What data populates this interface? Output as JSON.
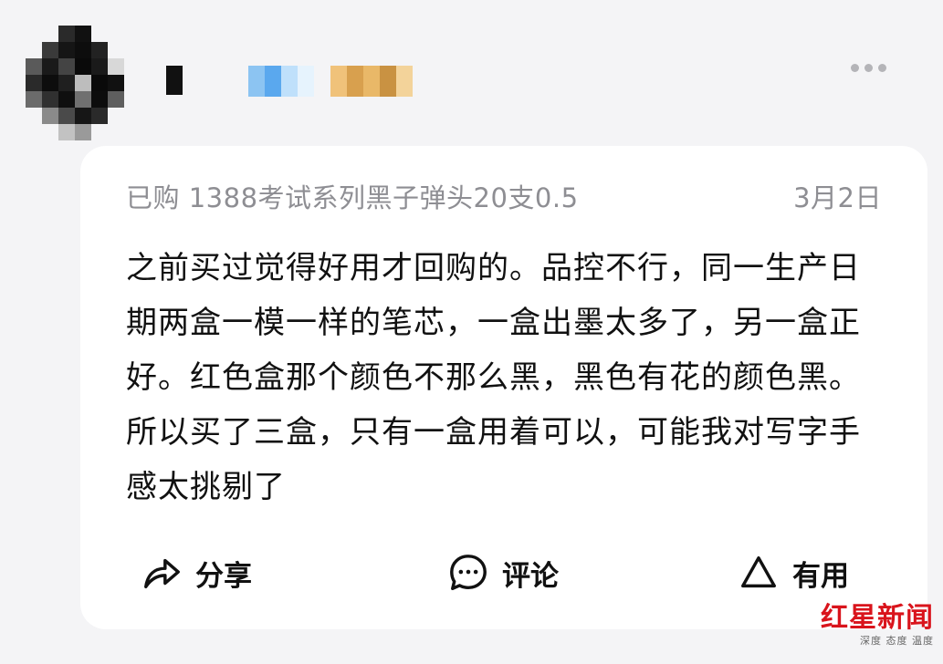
{
  "header": {
    "avatar_pixels": [
      [
        "#f4f4f6",
        "#f4f4f6",
        "#2a2a2a",
        "#111111",
        "#f4f4f6",
        "#f4f4f6",
        "#f4f4f6"
      ],
      [
        "#f4f4f6",
        "#3a3a3a",
        "#151515",
        "#0d0d0d",
        "#222222",
        "#f4f4f6",
        "#f4f4f6"
      ],
      [
        "#5a5a5a",
        "#1a1a1a",
        "#444444",
        "#0a0a0a",
        "#1a1a1a",
        "#d8d8d8",
        "#f4f4f6"
      ],
      [
        "#2a2a2a",
        "#0d0d0d",
        "#1f1f1f",
        "#bdbdbd",
        "#0a0a0a",
        "#111111",
        "#f4f4f6"
      ],
      [
        "#6b6b6b",
        "#303030",
        "#0f0f0f",
        "#707070",
        "#0c0c0c",
        "#5e5e5e",
        "#f4f4f6"
      ],
      [
        "#f4f4f6",
        "#8a8a8a",
        "#4a4a4a",
        "#161616",
        "#2a2a2a",
        "#f4f4f6",
        "#f4f4f6"
      ],
      [
        "#f4f4f6",
        "#f4f4f6",
        "#c2c2c2",
        "#9a9a9a",
        "#f4f4f6",
        "#f4f4f6",
        "#f4f4f6"
      ]
    ],
    "name_mosaic_blue": [
      "#8cc4f2",
      "#5aa8ee",
      "#bfe0fb",
      "#e6f3fd"
    ],
    "name_mosaic_gold": [
      "#f0c27a",
      "#d8a04e",
      "#e9b868",
      "#c99242",
      "#f3d39a"
    ]
  },
  "review": {
    "product_label": "已购 1388考试系列黑子弹头20支0.5",
    "date": "3月2日",
    "text": "之前买过觉得好用才回购的。品控不行，同一生产日期两盒一模一样的笔芯，一盒出墨太多了，另一盒正好。红色盒那个颜色不那么黑，黑色有花的颜色黑。所以买了三盒，只有一盒用着可以，可能我对写字手感太挑剔了"
  },
  "actions": {
    "share_label": "分享",
    "comment_label": "评论",
    "useful_label": "有用"
  },
  "watermark": {
    "title": "红星新闻",
    "subtitle": "深度 态度 温度"
  },
  "colors": {
    "background": "#f4f4f6",
    "card": "#ffffff",
    "meta_text": "#8e8e93",
    "watermark_red": "#d9141c"
  },
  "icons": {
    "share": "share-arrow-icon",
    "comment": "comment-bubble-icon",
    "useful": "triangle-useful-icon",
    "more": "more-dots-icon"
  }
}
